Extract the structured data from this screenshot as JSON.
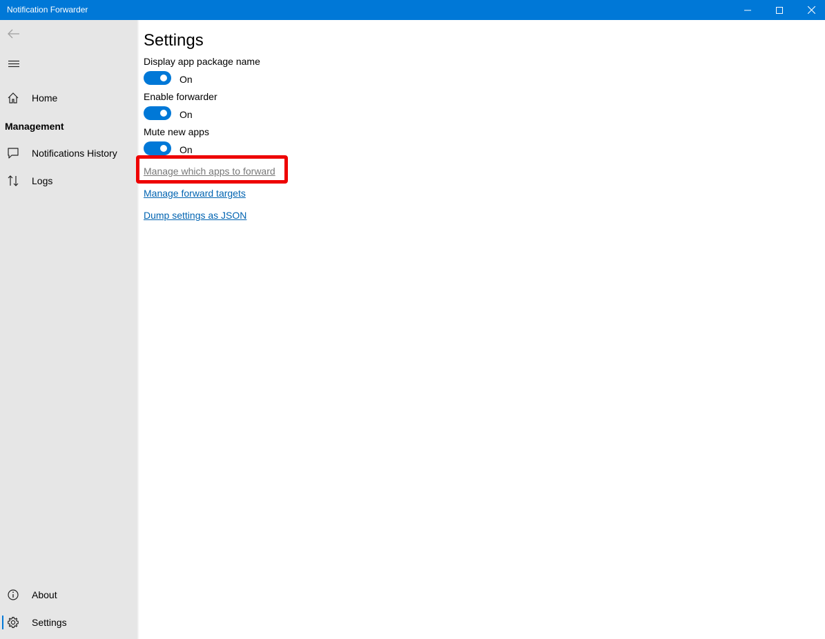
{
  "window": {
    "title": "Notification Forwarder"
  },
  "sidebar": {
    "items": [
      {
        "label": "Home",
        "icon": "home-icon"
      },
      {
        "label": "Notifications History",
        "icon": "message-icon"
      },
      {
        "label": "Logs",
        "icon": "sort-arrows-icon"
      }
    ],
    "section_header": "Management",
    "footer_items": [
      {
        "label": "About",
        "icon": "info-icon"
      },
      {
        "label": "Settings",
        "icon": "gear-icon",
        "selected": true
      }
    ]
  },
  "page": {
    "title": "Settings",
    "settings": [
      {
        "label": "Display app package name",
        "state": "On"
      },
      {
        "label": "Enable forwarder",
        "state": "On"
      },
      {
        "label": "Mute new apps",
        "state": "On"
      }
    ],
    "links": [
      {
        "label": "Manage which apps to forward",
        "highlighted": true
      },
      {
        "label": "Manage forward targets"
      },
      {
        "label": "Dump settings as JSON"
      }
    ]
  },
  "colors": {
    "accent": "#0078d7",
    "link": "#0063b1",
    "highlight": "#ee0000",
    "sidebar_bg": "#e6e6e6"
  }
}
